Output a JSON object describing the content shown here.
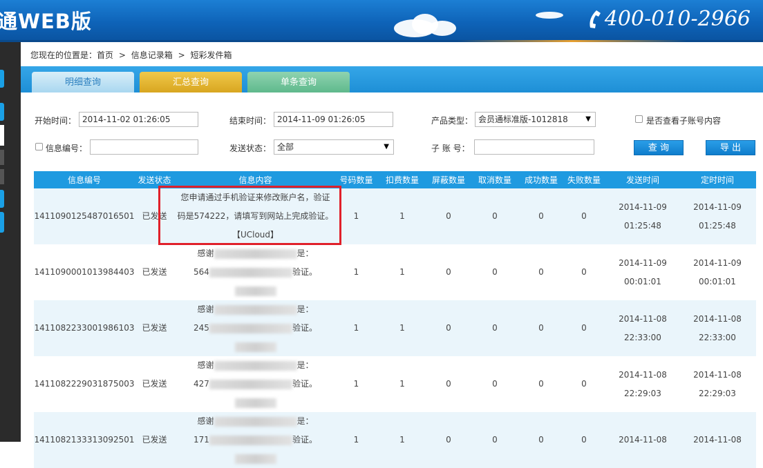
{
  "header": {
    "title": "通WEB版",
    "phone": "400-010-2966"
  },
  "breadcrumb": {
    "prefix": "您现在的位置是：",
    "items": [
      "首页",
      "信息记录箱",
      "短彩发件箱"
    ],
    "sep": ">"
  },
  "tabs": [
    {
      "label": "明细查询"
    },
    {
      "label": "汇总查询"
    },
    {
      "label": "单条查询"
    }
  ],
  "filters": {
    "start_label": "开始时间：",
    "start_value": "2014-11-02 01:26:05",
    "end_label": "结束时间：",
    "end_value": "2014-11-09 01:26:05",
    "product_label": "产品类型：",
    "product_value": "会员通标准版-1012818",
    "subaccount_check_label": "是否查看子账号内容",
    "msgid_label": "信息编号：",
    "msgid_value": "",
    "status_label": "发送状态：",
    "status_value": "全部",
    "subaccount_label": "子 账 号：",
    "subaccount_value": "",
    "query_button": "查 询",
    "export_button": "导 出"
  },
  "table": {
    "columns": [
      "信息编号",
      "发送状态",
      "信息内容",
      "号码数量",
      "扣费数量",
      "屏蔽数量",
      "取消数量",
      "成功数量",
      "失败数量",
      "发送时间",
      "定时时间"
    ],
    "rows": [
      {
        "id": "1411090125487016501",
        "status": "已发送",
        "content1": "您申请通过手机验证来修改账户名，验证",
        "content2": "码是574222，请填写到网站上完成验证。",
        "content3": "【UCloud】",
        "num": "1",
        "fee": "1",
        "blocked": "0",
        "cancel": "0",
        "success": "0",
        "fail": "0",
        "send_date": "2014-11-09",
        "send_time": "01:25:48",
        "sched_date": "2014-11-09",
        "sched_time": "01:25:48"
      },
      {
        "id": "1411090001013984403",
        "status": "已发送",
        "content1": "感谢",
        "content1b": "是：",
        "content2": "564",
        "content2b": "验证。",
        "num": "1",
        "fee": "1",
        "blocked": "0",
        "cancel": "0",
        "success": "0",
        "fail": "0",
        "send_date": "2014-11-09",
        "send_time": "00:01:01",
        "sched_date": "2014-11-09",
        "sched_time": "00:01:01"
      },
      {
        "id": "1411082233001986103",
        "status": "已发送",
        "content1": "感谢",
        "content1b": "是：",
        "content2": "245",
        "content2b": "验证。",
        "num": "1",
        "fee": "1",
        "blocked": "0",
        "cancel": "0",
        "success": "0",
        "fail": "0",
        "send_date": "2014-11-08",
        "send_time": "22:33:00",
        "sched_date": "2014-11-08",
        "sched_time": "22:33:00"
      },
      {
        "id": "1411082229031875003",
        "status": "已发送",
        "content1": "感谢",
        "content1b": "是：",
        "content2": "427",
        "content2b": "验证。",
        "num": "1",
        "fee": "1",
        "blocked": "0",
        "cancel": "0",
        "success": "0",
        "fail": "0",
        "send_date": "2014-11-08",
        "send_time": "22:29:03",
        "sched_date": "2014-11-08",
        "sched_time": "22:29:03"
      },
      {
        "id": "1411082133313092501",
        "status": "已发送",
        "content1": "感谢",
        "content1b": "是：",
        "content2": "171",
        "content2b": "验证。",
        "num": "1",
        "fee": "1",
        "blocked": "0",
        "cancel": "0",
        "success": "0",
        "fail": "0",
        "send_date": "2014-11-08",
        "send_time": "",
        "sched_date": "2014-11-08",
        "sched_time": ""
      }
    ]
  },
  "colors": {
    "header_blue": "#0e63b8",
    "table_header": "#1f9ae0",
    "highlight_red": "#e0202a",
    "row_alt": "#eaf5fb"
  }
}
